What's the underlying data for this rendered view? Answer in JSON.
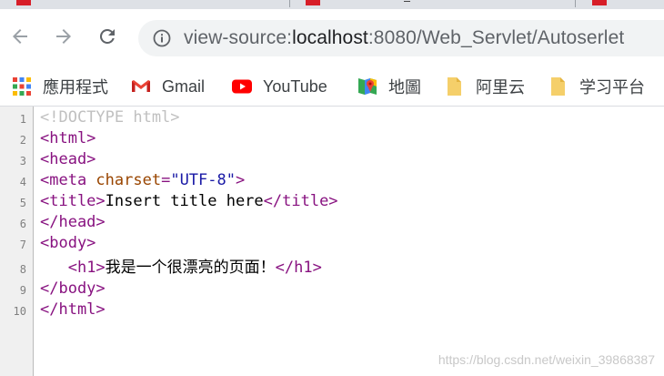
{
  "browser": {
    "address_bar": {
      "scheme": "view-source:",
      "host": "localhost",
      "path": ":8080/Web_Servlet/Autoserlet"
    },
    "nav": {
      "back_icon": "arrow-left-icon",
      "forward_icon": "arrow-right-icon",
      "reload_icon": "reload-icon",
      "info_icon": "info-icon"
    },
    "bookmarks": [
      {
        "label": "應用程式",
        "icon": "apps-grid-icon"
      },
      {
        "label": "Gmail",
        "icon": "gmail-icon"
      },
      {
        "label": "YouTube",
        "icon": "youtube-icon"
      },
      {
        "label": "地圖",
        "icon": "maps-icon"
      },
      {
        "label": "阿里云",
        "icon": "folder-icon"
      },
      {
        "label": "学习平台",
        "icon": "folder-icon"
      }
    ]
  },
  "source": {
    "line_numbers": [
      "1",
      "2",
      "3",
      "4",
      "5",
      "6",
      "7",
      "8",
      "9",
      "10"
    ],
    "lines": [
      [
        {
          "k": "doctype",
          "t": "<!DOCTYPE html>"
        }
      ],
      [
        {
          "k": "tag",
          "t": "<html>"
        }
      ],
      [
        {
          "k": "tag",
          "t": "<head>"
        }
      ],
      [
        {
          "k": "tag",
          "t": "<meta "
        },
        {
          "k": "attr",
          "t": "charset"
        },
        {
          "k": "tag",
          "t": "="
        },
        {
          "k": "val",
          "t": "\"UTF-8\""
        },
        {
          "k": "tag",
          "t": ">"
        }
      ],
      [
        {
          "k": "tag",
          "t": "<title>"
        },
        {
          "k": "text",
          "t": "Insert title here"
        },
        {
          "k": "tag",
          "t": "</title>"
        }
      ],
      [
        {
          "k": "tag",
          "t": "</head>"
        }
      ],
      [
        {
          "k": "tag",
          "t": "<body>"
        }
      ],
      [
        {
          "k": "text",
          "t": "   "
        },
        {
          "k": "tag",
          "t": "<h1>"
        },
        {
          "k": "text",
          "t": "我是一个很漂亮的页面！"
        },
        {
          "k": "tag",
          "t": "</h1>"
        }
      ],
      [
        {
          "k": "tag",
          "t": "</body>"
        }
      ],
      [
        {
          "k": "tag",
          "t": "</html>"
        }
      ]
    ],
    "watermark": "https://blog.csdn.net/weixin_39868387"
  },
  "colors": {
    "tag": "#881280",
    "attr": "#994500",
    "value": "#1a1aa6",
    "doctype": "#c0c0c0",
    "tab_accent": "#d71e28"
  }
}
